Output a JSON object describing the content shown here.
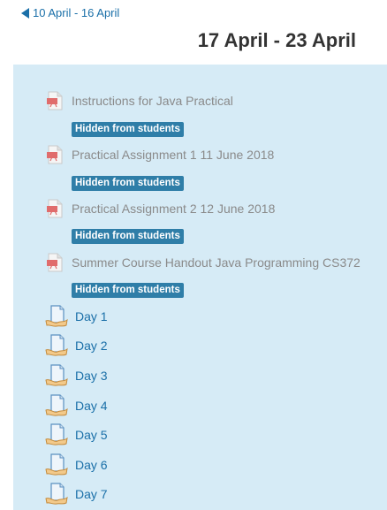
{
  "nav": {
    "prev_label": "10 April - 16 April"
  },
  "week": {
    "title": "17 April - 23 April"
  },
  "hidden_items": [
    {
      "label": "Instructions for Java Practical",
      "badge": "Hidden from students",
      "icon": "pdf-icon"
    },
    {
      "label": "Practical Assignment 1 11 June 2018",
      "badge": "Hidden from students",
      "icon": "pdf-icon"
    },
    {
      "label": "Practical Assignment 2 12 June 2018",
      "badge": "Hidden from students",
      "icon": "pdf-icon"
    },
    {
      "label": "Summer Course Handout Java Programming CS372",
      "badge": "Hidden from students",
      "icon": "pdf-icon"
    }
  ],
  "days": [
    {
      "label": "Day 1",
      "icon": "book-icon"
    },
    {
      "label": "Day 2",
      "icon": "book-icon"
    },
    {
      "label": "Day 3",
      "icon": "book-icon"
    },
    {
      "label": "Day 4",
      "icon": "book-icon"
    },
    {
      "label": "Day 5",
      "icon": "book-icon"
    },
    {
      "label": "Day 6",
      "icon": "book-icon"
    },
    {
      "label": "Day 7",
      "icon": "book-icon"
    }
  ],
  "colors": {
    "section_bg": "#d6ebf6",
    "link": "#1a6fa8",
    "badge_bg": "#2f7ea8",
    "muted_text": "#8a8a8a"
  }
}
